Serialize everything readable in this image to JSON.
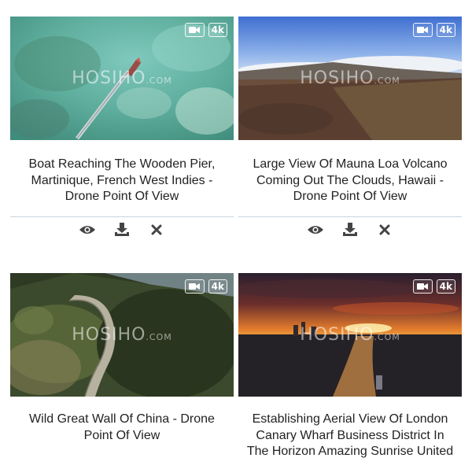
{
  "cards": [
    {
      "title": "Boat Reaching The Wooden Pier, Martinique, French West Indies - Drone Point Of View",
      "badge_quality": "4k",
      "watermark_main": "HOSIHO",
      "watermark_suffix": ".COM",
      "actions": [
        "eye-icon",
        "download-icon",
        "close-icon"
      ]
    },
    {
      "title": "Large View Of Mauna Loa Volcano Coming Out The Clouds, Hawaii - Drone Point Of View",
      "badge_quality": "4k",
      "watermark_main": "HOSIHO",
      "watermark_suffix": ".COM",
      "actions": [
        "eye-icon",
        "download-icon",
        "close-icon"
      ]
    },
    {
      "title": "Wild Great Wall Of China - Drone Point Of View",
      "badge_quality": "4k",
      "watermark_main": "HOSIHO",
      "watermark_suffix": ".COM"
    },
    {
      "title": "Establishing Aerial View Of London Canary Wharf Business District In The Horizon Amazing Sunrise United",
      "badge_quality": "4k",
      "watermark_main": "HOSIHO",
      "watermark_suffix": ".COM"
    }
  ],
  "colors": {
    "divider": "#c9d4dc",
    "icon": "#444444",
    "text": "#222222"
  }
}
